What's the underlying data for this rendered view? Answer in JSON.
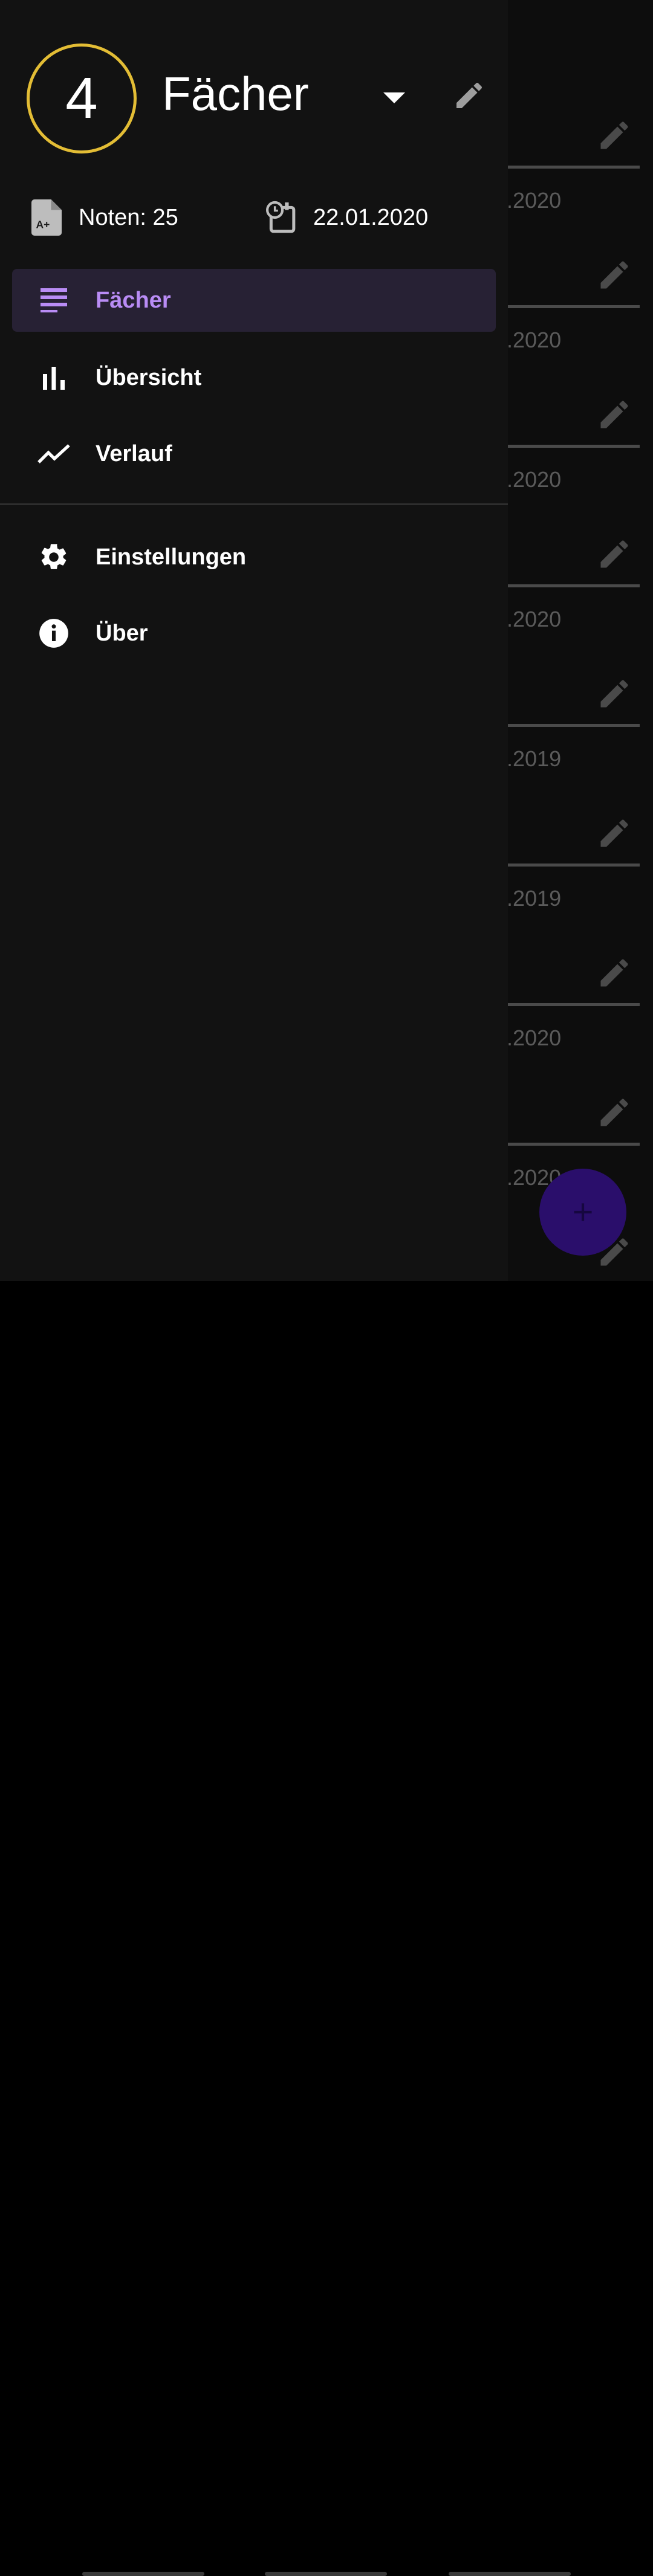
{
  "drawer": {
    "count": "4",
    "title": "Fächer",
    "notes_label": "Noten: 25",
    "date": "22.01.2020",
    "nav": [
      {
        "label": "Fächer",
        "icon": "list-icon",
        "active": true
      },
      {
        "label": "Übersicht",
        "icon": "bar-chart-icon",
        "active": false
      },
      {
        "label": "Verlauf",
        "icon": "trend-icon",
        "active": false
      }
    ],
    "secondary": [
      {
        "label": "Einstellungen",
        "icon": "gear-icon"
      },
      {
        "label": "Über",
        "icon": "info-icon"
      }
    ]
  },
  "background_list": {
    "dates": [
      ".2020",
      ".2020",
      ".2020",
      ".2020",
      ".2019",
      ".2019",
      ".2020",
      ".2020"
    ]
  },
  "colors": {
    "accent": "#b98cf5",
    "count_ring": "#e3bd35",
    "drawer_bg": "#121212",
    "active_item_bg": "#272134",
    "fab": "#2a0e6b"
  }
}
